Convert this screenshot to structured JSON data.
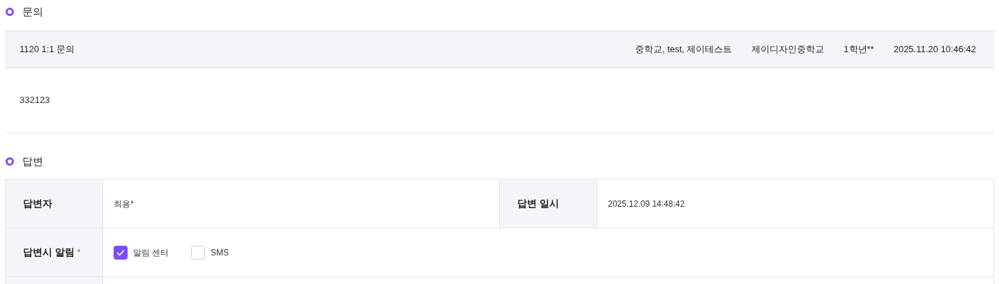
{
  "inquiry": {
    "heading": "문의",
    "title": "1120 1:1 문의",
    "meta": [
      "중학교, test, 제이테스트",
      "제이디자인중학교",
      "1학년**",
      "2025.11.20 10:46:42"
    ],
    "body": "332123"
  },
  "answer": {
    "heading": "답변",
    "rows": [
      {
        "kind": "pairs",
        "cells": [
          {
            "label": "답변자",
            "value": "최용*"
          },
          {
            "label": "답변 일시",
            "value": "2025.12.09 14:48:42"
          }
        ]
      },
      {
        "kind": "checks",
        "label": "답변시 알림",
        "required": true,
        "options": [
          {
            "label": "알림 센터",
            "checked": true
          },
          {
            "label": "SMS",
            "checked": false
          }
        ]
      },
      {
        "kind": "blank"
      }
    ]
  }
}
